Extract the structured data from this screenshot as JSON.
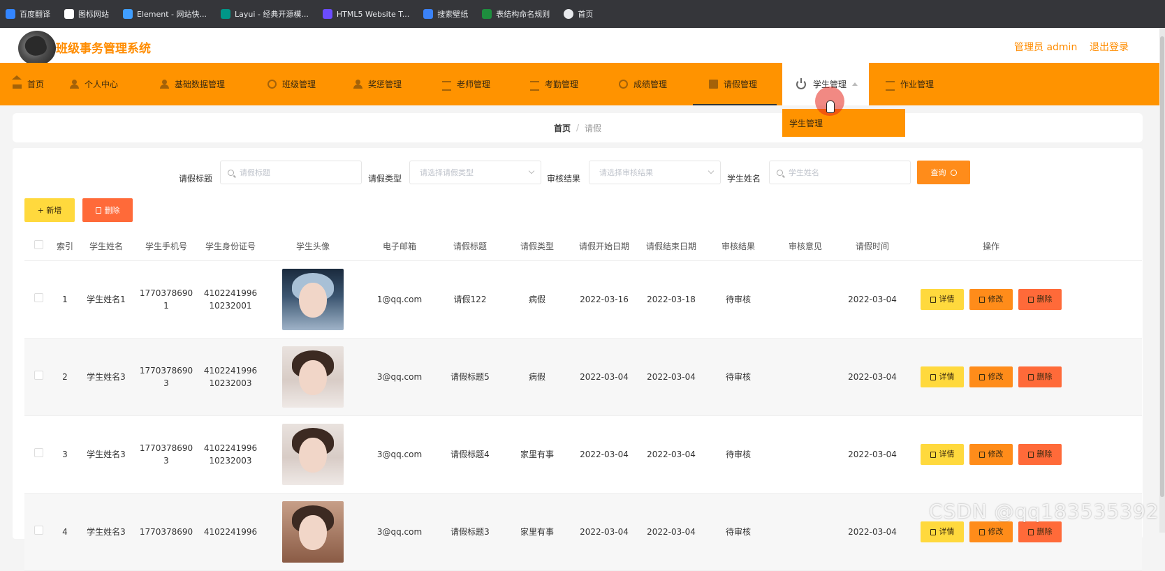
{
  "browser": {
    "bookmarks": [
      {
        "label": "百度翻译",
        "icon": "translate-icon",
        "color": "#3385ff"
      },
      {
        "label": "图标网站",
        "icon": "flag-icon",
        "color": "#ffffff"
      },
      {
        "label": "Element - 网站快...",
        "icon": "element-icon",
        "color": "#409eff"
      },
      {
        "label": "Layui - 经典开源模...",
        "icon": "layui-icon",
        "color": "#009688"
      },
      {
        "label": "HTML5 Website T...",
        "icon": "html5-icon",
        "color": "#6b4cff"
      },
      {
        "label": "搜索壁纸",
        "icon": "wallpaper-icon",
        "color": "#3b82f6"
      },
      {
        "label": "表结构命名规则",
        "icon": "sheet-icon",
        "color": "#1e8e3e"
      },
      {
        "label": "首页",
        "icon": "globe-icon",
        "color": "#e8eaed"
      }
    ]
  },
  "header": {
    "app_title": "班级事务管理系统",
    "admin_label": "管理员 admin",
    "logout_label": "退出登录"
  },
  "nav": {
    "items": [
      {
        "label": "首页",
        "icon": "home-icon"
      },
      {
        "label": "个人中心",
        "icon": "user-icon"
      },
      {
        "label": "基础数据管理",
        "icon": "user-icon"
      },
      {
        "label": "班级管理",
        "icon": "gear-icon"
      },
      {
        "label": "奖惩管理",
        "icon": "user-icon"
      },
      {
        "label": "老师管理",
        "icon": "bars-icon"
      },
      {
        "label": "考勤管理",
        "icon": "bars-icon"
      },
      {
        "label": "成绩管理",
        "icon": "gear-icon"
      },
      {
        "label": "请假管理",
        "icon": "doc-icon"
      },
      {
        "label": "学生管理",
        "icon": "power-icon"
      },
      {
        "label": "作业管理",
        "icon": "bars-icon"
      }
    ],
    "dropdown_item": "学生管理"
  },
  "breadcrumb": {
    "home": "首页",
    "separator": "/",
    "current": "请假"
  },
  "search": {
    "title_label": "请假标题",
    "title_placeholder": "请假标题",
    "type_label": "请假类型",
    "type_placeholder": "请选择请假类型",
    "result_label": "审核结果",
    "result_placeholder": "请选择审核结果",
    "name_label": "学生姓名",
    "name_placeholder": "学生姓名",
    "query_button": "查询"
  },
  "toolbar": {
    "add_label": "+ 新增",
    "delete_label": "删除"
  },
  "table": {
    "columns": [
      "索引",
      "学生姓名",
      "学生手机号",
      "学生身份证号",
      "学生头像",
      "电子邮箱",
      "请假标题",
      "请假类型",
      "请假开始日期",
      "请假结束日期",
      "审核结果",
      "审核意见",
      "请假时间",
      "操作"
    ],
    "rows": [
      {
        "index": "1",
        "name": "学生姓名1",
        "phone_a": "1770378690",
        "phone_b": "1",
        "id_a": "4102241996",
        "id_b": "10232001",
        "email": "1@qq.com",
        "title": "请假122",
        "type": "病假",
        "start": "2022-03-16",
        "end": "2022-03-18",
        "result": "待审核",
        "opinion": "",
        "time": "2022-03-04"
      },
      {
        "index": "2",
        "name": "学生姓名3",
        "phone_a": "1770378690",
        "phone_b": "3",
        "id_a": "4102241996",
        "id_b": "10232003",
        "email": "3@qq.com",
        "title": "请假标题5",
        "type": "病假",
        "start": "2022-03-04",
        "end": "2022-03-04",
        "result": "待审核",
        "opinion": "",
        "time": "2022-03-04"
      },
      {
        "index": "3",
        "name": "学生姓名3",
        "phone_a": "1770378690",
        "phone_b": "3",
        "id_a": "4102241996",
        "id_b": "10232003",
        "email": "3@qq.com",
        "title": "请假标题4",
        "type": "家里有事",
        "start": "2022-03-04",
        "end": "2022-03-04",
        "result": "待审核",
        "opinion": "",
        "time": "2022-03-04"
      },
      {
        "index": "4",
        "name": "学生姓名3",
        "phone_a": "1770378690",
        "phone_b": "",
        "id_a": "4102241996",
        "id_b": "",
        "email": "3@qq.com",
        "title": "请假标题3",
        "type": "家里有事",
        "start": "2022-03-04",
        "end": "2022-03-04",
        "result": "待审核",
        "opinion": "",
        "time": "2022-03-04"
      }
    ],
    "actions": {
      "detail": "详情",
      "edit": "修改",
      "delete": "删除"
    }
  },
  "watermark": "CSDN @qq183535392",
  "colors": {
    "accent": "#ff9300",
    "warning": "#ffd93d",
    "danger": "#ff6a39"
  }
}
